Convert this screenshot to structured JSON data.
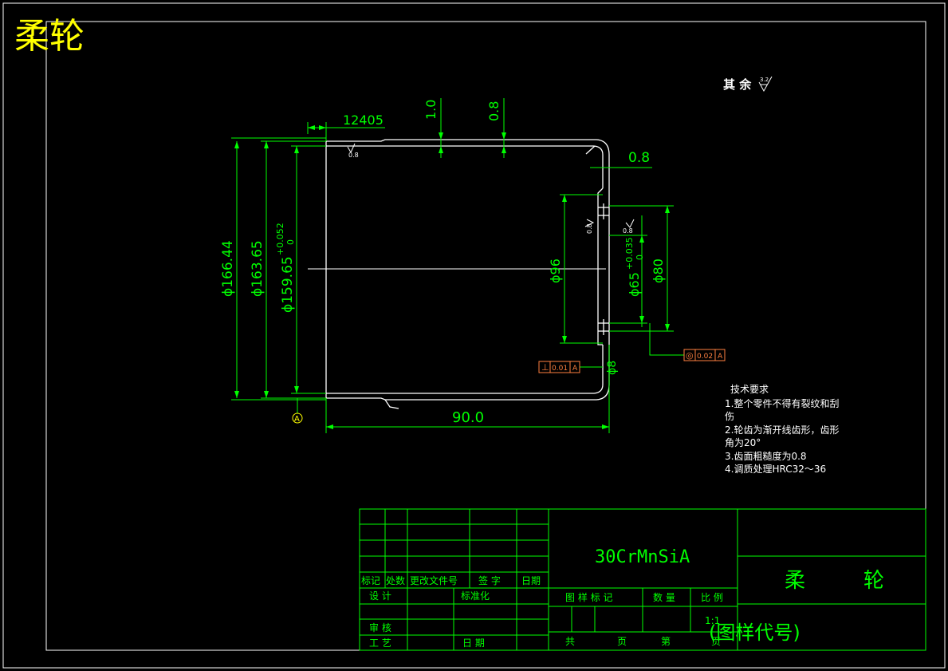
{
  "title": "柔轮",
  "surface_note": "其 余",
  "surface_symbol_value": "3.2",
  "dimensions": {
    "top_offset": "12405",
    "wall_1": "1.0",
    "wall_2": "0.8",
    "end_wall": "0.8",
    "d_outer": "ϕ166.44",
    "d_mid": "ϕ163.65",
    "d_inner": "ϕ159.65",
    "d_inner_tol_upper": "+0.052",
    "d_inner_tol_lower": "0",
    "d_96": "ϕ96",
    "d_65": "ϕ65",
    "d_65_tol_upper": "+0.035",
    "d_65_tol_lower": "0",
    "d_80": "ϕ80",
    "d_8": "ϕ8",
    "length": "90.0",
    "rough_a": "0.8",
    "rough_b": "0.8",
    "rough_c": "0.8"
  },
  "datum": "A",
  "tolerances": {
    "perp_symbol": "⊥",
    "perp_value": "0.01",
    "perp_datum": "A",
    "conc_symbol": "◎",
    "conc_value": "0.02",
    "conc_datum": "A"
  },
  "tech_requirements": {
    "heading": "技术要求",
    "lines": [
      "1.整个零件不得有裂纹和刮",
      "伤",
      "2.轮齿为渐开线齿形，齿形",
      "角为20°",
      "3.齿面粗糙度为0.8",
      "4.调质处理HRC32～36"
    ]
  },
  "title_block": {
    "material": "30CrMnSiA",
    "part_name_left": "柔",
    "part_name_right": "轮",
    "drawing_code": "(图样代号)",
    "scale_value": "1:1",
    "labels": {
      "mark": "标记",
      "count": "处数",
      "change_doc": "更改文件号",
      "sign": "签 字",
      "date": "日期",
      "design": "设 计",
      "standard": "标准化",
      "drawing_mark": "图 样 标 记",
      "quantity": "数 量",
      "scale": "比 例",
      "review": "审 核",
      "process": "工 艺",
      "date2": "日 期",
      "total": "共",
      "sheet": "页",
      "no": "第",
      "sheet2": "页"
    }
  },
  "colors": {
    "background": "#000000",
    "border": "#ffffff",
    "dimension": "#00ff00",
    "title": "#ffff00",
    "tolerance_box": "#ff8040",
    "text": "#ffffff"
  }
}
